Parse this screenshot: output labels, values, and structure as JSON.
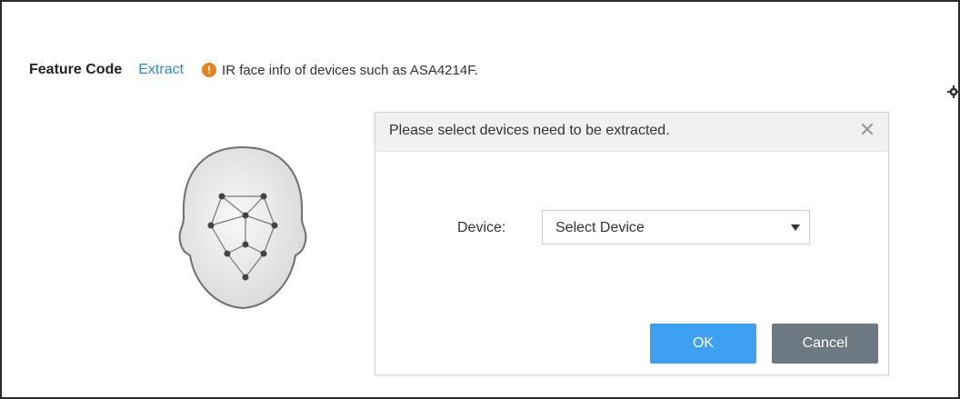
{
  "header": {
    "title": "Feature Code",
    "extract_link": "Extract",
    "info_text": "IR face info of devices such as ASA4214F.",
    "info_icon": "warning-circle-icon"
  },
  "dialog": {
    "title": "Please select devices need to be extracted.",
    "close_symbol": "✕",
    "device_label": "Device:",
    "device_select_value": "Select Device",
    "ok_label": "OK",
    "cancel_label": "Cancel"
  },
  "colors": {
    "link": "#2a8ce0",
    "warning": "#e8821c",
    "ok_button": "#3ea0f0",
    "cancel_button": "#6c7983"
  }
}
